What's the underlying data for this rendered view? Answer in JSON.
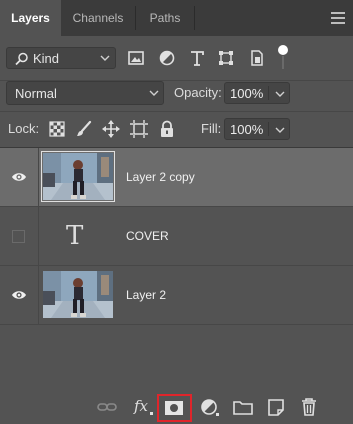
{
  "tabs": [
    {
      "label": "Layers",
      "active": true
    },
    {
      "label": "Channels",
      "active": false
    },
    {
      "label": "Paths",
      "active": false
    }
  ],
  "filter": {
    "kind_label": "Kind",
    "icons": [
      "image-filter-icon",
      "adjustment-filter-icon",
      "type-filter-icon",
      "shape-filter-icon",
      "smart-object-filter-icon",
      "filter-toggle-icon"
    ]
  },
  "blend": {
    "mode": "Normal",
    "opacity_label": "Opacity:",
    "opacity_value": "100%",
    "fill_label": "Fill:",
    "fill_value": "100%"
  },
  "lock": {
    "label": "Lock:",
    "icons": [
      "lock-transparent-pixels-icon",
      "lock-image-pixels-icon",
      "lock-position-icon",
      "lock-artboard-icon",
      "lock-all-icon"
    ]
  },
  "layers": [
    {
      "name": "Layer 2 copy",
      "type": "image",
      "visible": true,
      "selected": true
    },
    {
      "name": "COVER",
      "type": "text",
      "visible": false,
      "selected": false
    },
    {
      "name": "Layer 2",
      "type": "image",
      "visible": true,
      "selected": false
    }
  ],
  "text_layer_glyph": "T",
  "bottom_icons": [
    "link-layers-icon",
    "fx-icon",
    "add-mask-icon",
    "adjustment-layer-icon",
    "new-group-icon",
    "new-layer-icon",
    "delete-layer-icon"
  ],
  "fx_label": "fx",
  "colors": {
    "panel_bg": "#535353",
    "tab_bar_bg": "#3b3b3b",
    "selected_row_bg": "#6c6c6c",
    "highlight_border": "#e0252b"
  }
}
